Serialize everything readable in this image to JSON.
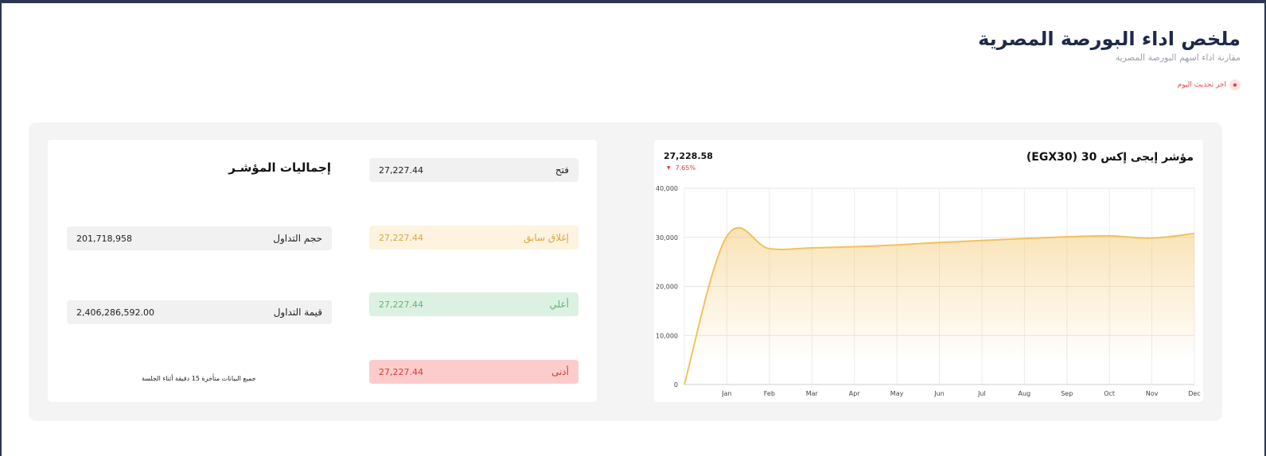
{
  "header": {
    "title": "ملخص اداء البورصة المصرية",
    "subtitle": "مقارنة اداء اسهم البورصة المصرية",
    "last_update_label": "اخر تحديث اليوم"
  },
  "totals": {
    "title": "إجماليات المؤشـر",
    "open": {
      "label": "فتح",
      "value": "27,227.44"
    },
    "prev_close": {
      "label": "إغلاق سابق",
      "value": "27,227.44"
    },
    "high": {
      "label": "أعلي",
      "value": "27,227.44"
    },
    "low": {
      "label": "أدنى",
      "value": "27,227.44"
    },
    "volume": {
      "label": "حجم التداول",
      "value": "201,718,958"
    },
    "turnover": {
      "label": "قيمة التداول",
      "value": "2,406,286,592.00"
    },
    "disclaimer": "جميع البيانات متأخرة 15 دقيقة أثناء الجلسة"
  },
  "index_card": {
    "title": "مؤشر إيجى إكس 30 (EGX30)",
    "value": "27,228.58",
    "change": "7.65%",
    "change_icon": "down-triangle-icon"
  },
  "colors": {
    "accent": "#f3c15c",
    "frame": "#2c3651",
    "down": "#e23b3b"
  },
  "chart_data": {
    "type": "area",
    "x": [
      "",
      "Jan",
      "Feb",
      "Mar",
      "Apr",
      "May",
      "Jun",
      "Jul",
      "Aug",
      "Sep",
      "Oct",
      "Nov",
      "Dec"
    ],
    "series": [
      {
        "values": [
          0,
          30200,
          27700,
          27850,
          28100,
          28450,
          28950,
          29350,
          29750,
          30100,
          30300,
          29850,
          30800
        ]
      }
    ],
    "y_ticks": [
      0,
      10000,
      20000,
      30000,
      40000
    ],
    "y_tick_labels": [
      "0",
      "10,000",
      "20,000",
      "30,000",
      "40,000"
    ],
    "ylim": [
      0,
      40000
    ],
    "grid": true,
    "legend": "none"
  }
}
